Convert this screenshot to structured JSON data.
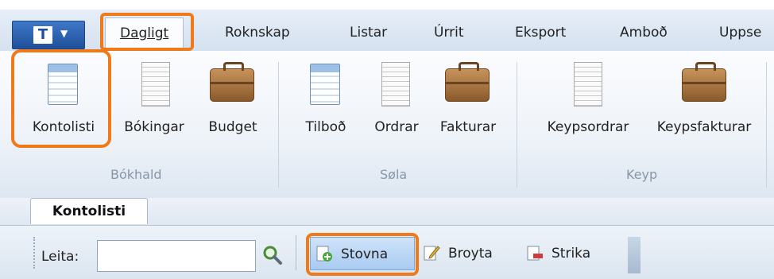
{
  "app_menu": {
    "logo_letter": "T",
    "caret": "▼"
  },
  "tabs": [
    {
      "label": "Dagligt",
      "active": true
    },
    {
      "label": "Roknskap"
    },
    {
      "label": "Listar"
    },
    {
      "label": "Úrrit"
    },
    {
      "label": "Eksport"
    },
    {
      "label": "Amboð"
    },
    {
      "label": "Uppse"
    }
  ],
  "ribbon": {
    "groups": [
      {
        "label": "Bókhald",
        "items": [
          "Kontolisti",
          "Bókingar",
          "Budget"
        ]
      },
      {
        "label": "Søla",
        "items": [
          "Tilboð",
          "Ordrar",
          "Fakturar"
        ]
      },
      {
        "label": "Keyp",
        "items": [
          "Keypsordrar",
          "Keypsfakturar"
        ]
      }
    ]
  },
  "document_tab": {
    "label": "Kontolisti"
  },
  "toolbar": {
    "search_label": "Leita:",
    "search_value": "",
    "buttons": [
      "Stovna",
      "Broyta",
      "Strika"
    ]
  },
  "colors": {
    "highlight": "#f07a1a",
    "accent": "#1f4f9a"
  }
}
